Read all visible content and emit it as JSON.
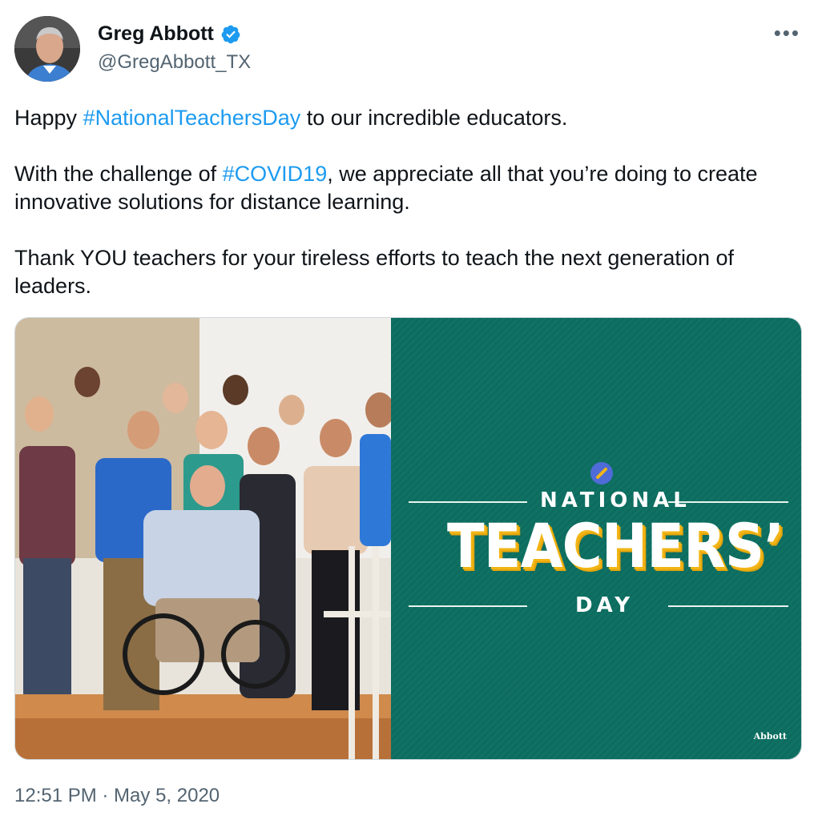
{
  "author": {
    "name": "Greg Abbott",
    "handle": "@GregAbbott_TX",
    "verified_icon": "verified-badge-icon"
  },
  "menu": {
    "more_label": "•••"
  },
  "tweet": {
    "p1_before": "Happy ",
    "p1_tag": "#NationalTeachersDay",
    "p1_after": " to our incredible educators.",
    "p2_before": "With the challenge of ",
    "p2_tag": "#COVID19",
    "p2_after": ", we appreciate all that you’re doing to create innovative solutions for distance learning.",
    "p3": "Thank YOU teachers for your tireless efforts to teach the next generation of leaders."
  },
  "media": {
    "graphic": {
      "top_word": "NATIONAL",
      "big_word": "TEACHERS’",
      "bottom_word": "DAY",
      "logo_text": "Abbott"
    },
    "colors": {
      "panel": "#0f7263",
      "accent": "#f2b515"
    }
  },
  "timestamp": "12:51 PM · May 5, 2020",
  "colors": {
    "link": "#1d9bf0",
    "secondary": "#536471",
    "verified": "#1d9bf0"
  }
}
